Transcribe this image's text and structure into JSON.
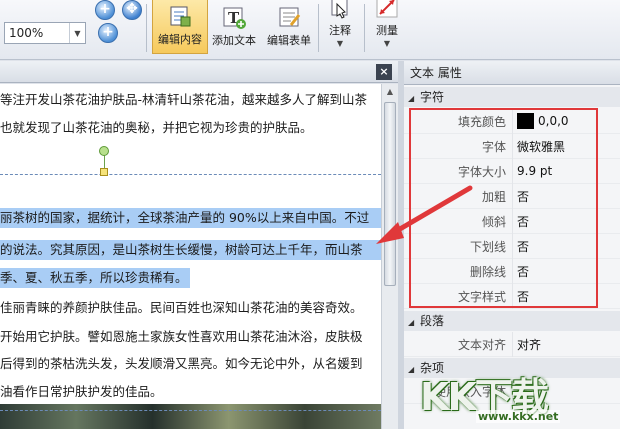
{
  "toolbar": {
    "zoom": "100%",
    "buttons": [
      {
        "label": "编辑内容"
      },
      {
        "label": "添加文本"
      },
      {
        "label": "编辑表单"
      },
      {
        "label": "注释"
      },
      {
        "label": "测量"
      }
    ],
    "zoom_in": "+",
    "zoom_out": "+"
  },
  "doc": {
    "close": "×",
    "lines": [
      "等注开发山茶花油护肤品-林清轩山茶花油，越来越多人了解到山茶",
      "也就发现了山茶花油的奥秘，并把它视为珍贵的护肤品。",
      "丽茶树的国家，据统计，全球茶油产量的 90%以上来自中国。不过",
      "的说法。究其原因，是山茶树生长缓慢，树龄可达上千年，而山茶",
      "季、夏、秋五季，所以珍贵稀有。",
      "佳丽青睐的养颜护肤佳品。民间百姓也深知山茶花油的美容奇效。",
      "开始用它护肤。譬如恩施土家族女性喜欢用山茶花油沐浴，皮肤极",
      "后得到的茶枯洗头发，头发顺滑又黑亮。如今无论中外，从名媛到",
      "油看作日常护肤护发的佳品。"
    ]
  },
  "props": {
    "title": "文本 属性",
    "categories": {
      "char": "字符",
      "para": "段落",
      "misc": "杂项"
    },
    "char_rows": [
      {
        "k": "填充颜色",
        "v": "0,0,0"
      },
      {
        "k": "字体",
        "v": "微软雅黑"
      },
      {
        "k": "字体大小",
        "v": "9.9 pt"
      },
      {
        "k": "加粗",
        "v": "否"
      },
      {
        "k": "倾斜",
        "v": "否"
      },
      {
        "k": "下划线",
        "v": "否"
      },
      {
        "k": "删除线",
        "v": "否"
      },
      {
        "k": "文字样式",
        "v": "否"
      }
    ],
    "para_rows": [
      {
        "k": "文本对齐",
        "v": "对齐"
      }
    ],
    "misc_rows": [
      {
        "k": "使用嵌入字体",
        "v": "是"
      }
    ],
    "fill_color": "#000000",
    "highlight_box_color": "#e0383a"
  },
  "watermark": {
    "letters": "KK下载",
    "url": "www.kkx.net"
  }
}
